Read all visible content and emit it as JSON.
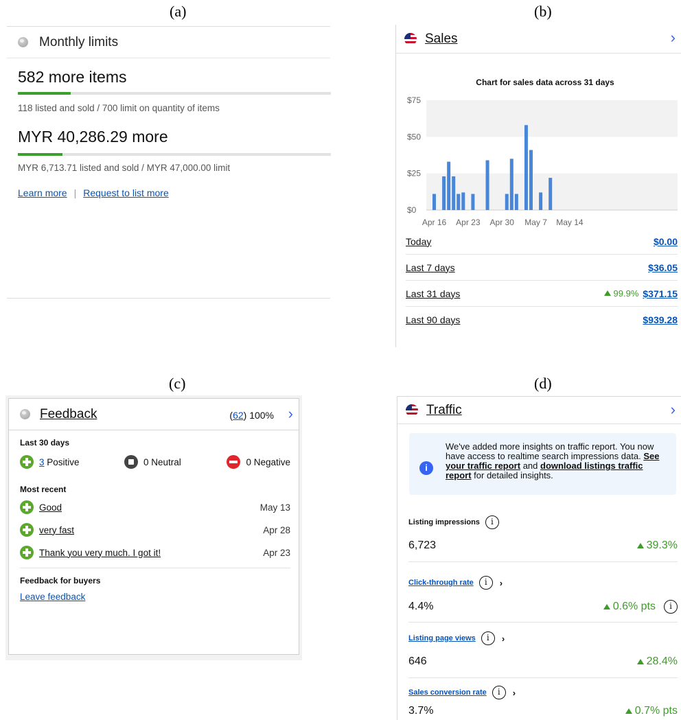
{
  "labels": {
    "a": "(a)",
    "b": "(b)",
    "c": "(c)",
    "d": "(d)"
  },
  "monthly_limits": {
    "title": "Monthly limits",
    "items_headline": "582 more items",
    "items_fill_fraction": 0.169,
    "items_detail": "118 listed and sold /  700 limit on quantity of items",
    "value_headline": "MYR 40,286.29 more",
    "value_fill_fraction": 0.143,
    "value_detail": "MYR 6,713.71 listed and sold /  MYR 47,000.00 limit",
    "learn_more": "Learn more",
    "separator": "|",
    "request_more": "Request to list more"
  },
  "sales": {
    "title": "Sales",
    "chevron": "›",
    "rows": [
      {
        "label": "Today",
        "change": "",
        "amount": "$0.00"
      },
      {
        "label": "Last 7 days",
        "change": "",
        "amount": "$36.05"
      },
      {
        "label": "Last 31 days",
        "change": "99.9%",
        "amount": "$371.15"
      },
      {
        "label": "Last 90 days",
        "change": "",
        "amount": "$939.28"
      }
    ],
    "colors": {
      "bar": "#4a86d8",
      "band": "#f2f2f2"
    }
  },
  "chart_data": {
    "type": "bar",
    "title": "Chart for sales data across 31 days",
    "xlabel": "",
    "ylabel": "",
    "ylim": [
      0,
      75
    ],
    "yticks": [
      "$0",
      "$25",
      "$50",
      "$75"
    ],
    "xticks": [
      {
        "label": "Apr 16",
        "day": 0
      },
      {
        "label": "Apr 23",
        "day": 7
      },
      {
        "label": "Apr 30",
        "day": 14
      },
      {
        "label": "May 7",
        "day": 21
      },
      {
        "label": "May 14",
        "day": 28
      }
    ],
    "categories": [
      "Apr 15",
      "Apr 16",
      "Apr 17",
      "Apr 18",
      "Apr 19",
      "Apr 20",
      "Apr 21",
      "Apr 22",
      "Apr 23",
      "Apr 24",
      "Apr 25",
      "Apr 26",
      "Apr 27",
      "Apr 28",
      "Apr 29",
      "Apr 30",
      "May 1",
      "May 2",
      "May 3",
      "May 4",
      "May 5",
      "May 6",
      "May 7",
      "May 8",
      "May 9",
      "May 10",
      "May 11",
      "May 12",
      "May 13",
      "May 14",
      "May 15"
    ],
    "values": [
      0,
      11,
      0,
      23,
      33,
      23,
      11,
      12,
      0,
      11,
      0,
      0,
      34,
      0,
      0,
      0,
      11,
      35,
      11,
      0,
      58,
      41,
      0,
      12,
      0,
      22,
      0,
      0,
      0,
      0,
      0
    ]
  },
  "feedback": {
    "title": "Feedback",
    "count_open": "(",
    "count": "62",
    "count_close": ") 100%",
    "chevron": "›",
    "last30_title": "Last 30 days",
    "positive_count": "3",
    "positive_label": "Positive",
    "neutral": "0 Neutral",
    "negative": "0 Negative",
    "recent_title": "Most recent",
    "recent": [
      {
        "text": "Good",
        "date": "May 13"
      },
      {
        "text": "very fast",
        "date": "Apr 28"
      },
      {
        "text": "Thank you very much. I got it!",
        "date": "Apr 23"
      }
    ],
    "buyers_title": "Feedback for buyers",
    "leave_feedback": "Leave feedback",
    "colors": {
      "positive": "#5ba82c",
      "neutral": "#444444",
      "negative": "#e0262c"
    }
  },
  "traffic": {
    "title": "Traffic",
    "chevron": "›",
    "info_icon": "i",
    "info_pre": "We've added more insights on traffic report. You now have access to realtime search impressions data. ",
    "info_link1": "See your traffic report",
    "info_mid": " and ",
    "info_link2": "download listings traffic report",
    "info_post": " for detailed insights.",
    "metrics": [
      {
        "title": "Listing impressions",
        "value": "6,723",
        "change": "39.3%",
        "linked": false,
        "chevron": "",
        "extra_info": false
      },
      {
        "title": "Click-through rate",
        "value": "4.4%",
        "change": "0.6% pts",
        "linked": true,
        "chevron": "›",
        "extra_info": true
      },
      {
        "title": "Listing page views",
        "value": "646",
        "change": "28.4%",
        "linked": true,
        "chevron": "›",
        "extra_info": false
      },
      {
        "title": "Sales conversion rate",
        "value": "3.7%",
        "change": "0.7% pts",
        "linked": true,
        "chevron": "›",
        "extra_info": false
      }
    ],
    "colors": {
      "positive": "#3f9b2a",
      "accent": "#3665f3"
    }
  }
}
